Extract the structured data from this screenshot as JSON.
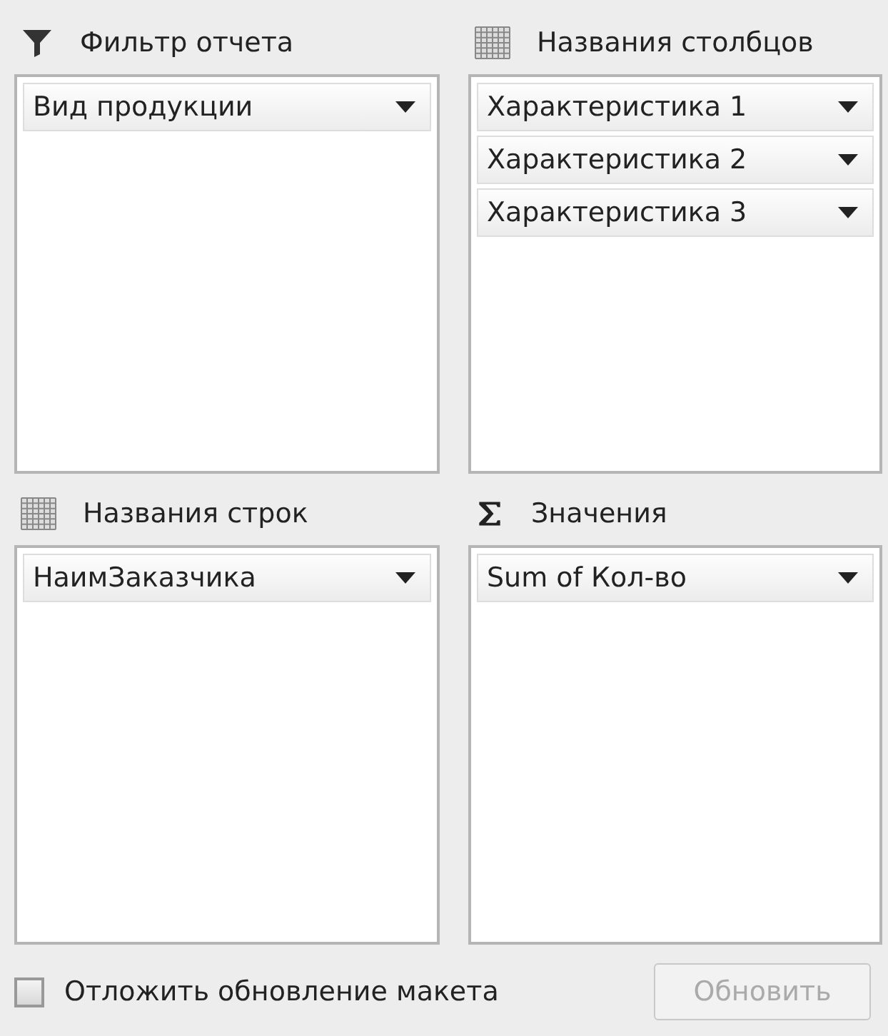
{
  "areas": [
    {
      "kind": "filter",
      "title": "Фильтр отчета",
      "fields": [
        "Вид продукции"
      ]
    },
    {
      "kind": "columns",
      "title": "Названия столбцов",
      "fields": [
        "Характеристика 1",
        "Характеристика 2",
        "Характеристика 3"
      ]
    },
    {
      "kind": "rows",
      "title": "Названия строк",
      "fields": [
        "НаимЗаказчика"
      ]
    },
    {
      "kind": "values",
      "title": "Значения",
      "fields": [
        "Sum of Кол-во"
      ]
    }
  ],
  "defer_update": {
    "label": "Отложить обновление макета",
    "checked": false
  },
  "update_button": {
    "label": "Обновить",
    "disabled": true
  }
}
